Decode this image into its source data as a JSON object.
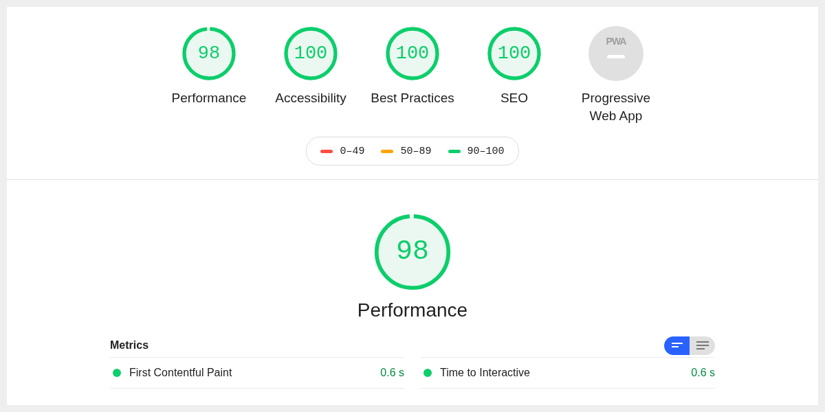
{
  "gauges": [
    {
      "kind": "score",
      "score": "98",
      "label": "Performance"
    },
    {
      "kind": "score",
      "score": "100",
      "label": "Accessibility"
    },
    {
      "kind": "score",
      "score": "100",
      "label": "Best Practices"
    },
    {
      "kind": "score",
      "score": "100",
      "label": "SEO"
    },
    {
      "kind": "pwa",
      "badge": "PWA",
      "label": "Progressive Web App"
    }
  ],
  "legend": [
    {
      "color": "#ff4e42",
      "label": "0–49"
    },
    {
      "color": "#ffa400",
      "label": "50–89"
    },
    {
      "color": "#0cce6b",
      "label": "90–100"
    }
  ],
  "category": {
    "score": "98",
    "title": "Performance"
  },
  "metrics": {
    "title": "Metrics",
    "view_toggle": [
      {
        "kind": "summary",
        "selected": true
      },
      {
        "kind": "detailed",
        "selected": false
      }
    ],
    "items": [
      {
        "name": "First Contentful Paint",
        "value": "0.6 s"
      },
      {
        "name": "Time to Interactive",
        "value": "0.6 s"
      }
    ]
  }
}
